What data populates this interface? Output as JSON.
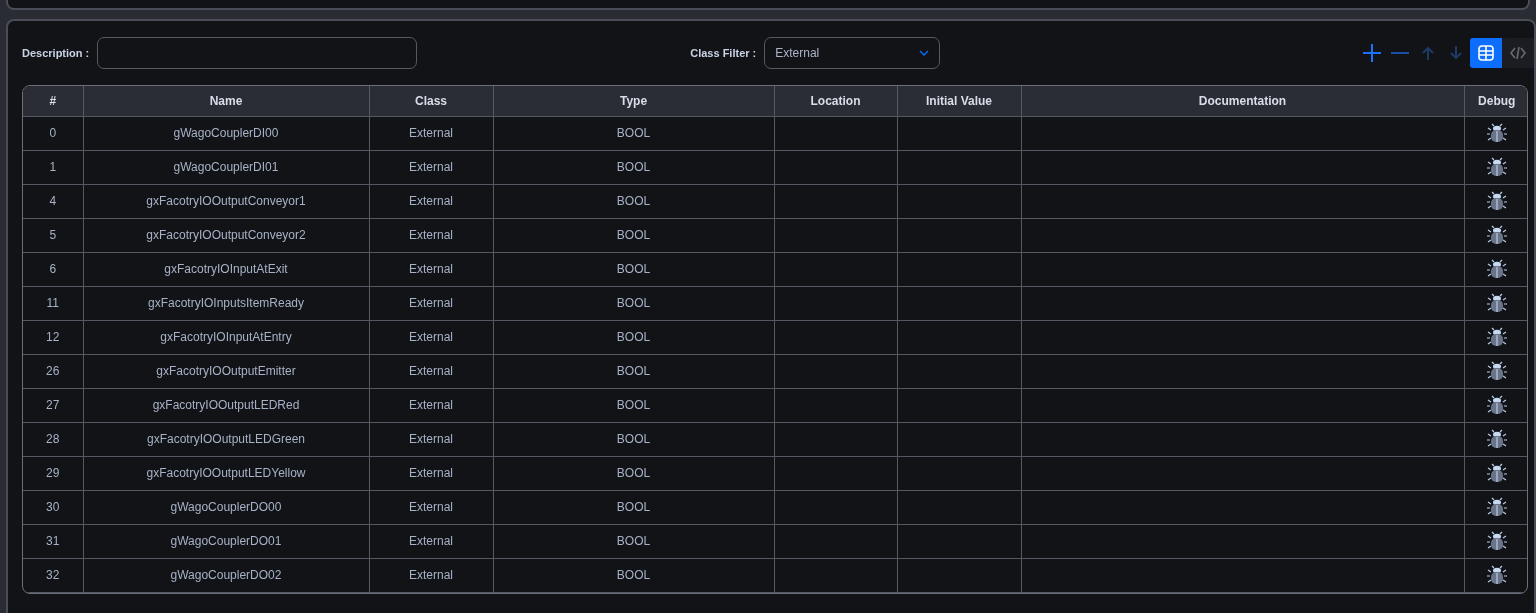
{
  "filters": {
    "description": {
      "label": "Description :"
    },
    "class_filter": {
      "label": "Class Filter :",
      "value": "External"
    }
  },
  "toolbar": [
    {
      "kind": "add",
      "disabled": false
    },
    {
      "kind": "remove",
      "disabled": false
    },
    {
      "kind": "up",
      "disabled": true
    },
    {
      "kind": "down",
      "disabled": true
    }
  ],
  "views": [
    {
      "kind": "table",
      "selected": true
    },
    {
      "kind": "code",
      "selected": false
    }
  ],
  "table": {
    "columns": [
      "#",
      "Name",
      "Class",
      "Type",
      "Location",
      "Initial Value",
      "Documentation",
      "Debug"
    ],
    "rows": [
      [
        "0",
        "gWagoCouplerDI00",
        "External",
        "BOOL",
        "",
        "",
        ""
      ],
      [
        "1",
        "gWagoCouplerDI01",
        "External",
        "BOOL",
        "",
        "",
        ""
      ],
      [
        "4",
        "gxFacotryIOOutputConveyor1",
        "External",
        "BOOL",
        "",
        "",
        ""
      ],
      [
        "5",
        "gxFacotryIOOutputConveyor2",
        "External",
        "BOOL",
        "",
        "",
        ""
      ],
      [
        "6",
        "gxFacotryIOInputAtExit",
        "External",
        "BOOL",
        "",
        "",
        ""
      ],
      [
        "11",
        "gxFacotryIOInputsItemReady",
        "External",
        "BOOL",
        "",
        "",
        ""
      ],
      [
        "12",
        "gxFacotryIOInputAtEntry",
        "External",
        "BOOL",
        "",
        "",
        ""
      ],
      [
        "26",
        "gxFacotryIOOutputEmitter",
        "External",
        "BOOL",
        "",
        "",
        ""
      ],
      [
        "27",
        "gxFacotryIOOutputLEDRed",
        "External",
        "BOOL",
        "",
        "",
        ""
      ],
      [
        "28",
        "gxFacotryIOOutputLEDGreen",
        "External",
        "BOOL",
        "",
        "",
        ""
      ],
      [
        "29",
        "gxFacotryIOOutputLEDYellow",
        "External",
        "BOOL",
        "",
        "",
        ""
      ],
      [
        "30",
        "gWagoCouplerDO00",
        "External",
        "BOOL",
        "",
        "",
        ""
      ],
      [
        "31",
        "gWagoCouplerDO01",
        "External",
        "BOOL",
        "",
        "",
        ""
      ],
      [
        "32",
        "gWagoCouplerDO02",
        "External",
        "BOOL",
        "",
        "",
        ""
      ]
    ]
  }
}
